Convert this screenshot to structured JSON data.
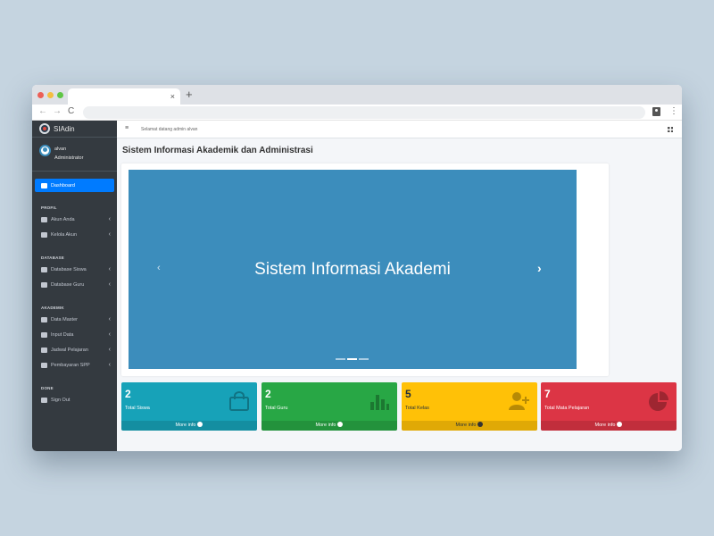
{
  "browser": {
    "tab_close": "×",
    "new_tab": "+",
    "back": "←",
    "forward": "→",
    "reload": "C",
    "menu": "⋮"
  },
  "sidebar": {
    "brand": "SIAdin",
    "user": {
      "name": "alvan",
      "role": "Administrator"
    },
    "items": [
      {
        "type": "item",
        "label": "Dashboard",
        "icon": "home-icon",
        "active": true
      },
      {
        "type": "header",
        "label": "PROFIL"
      },
      {
        "type": "item",
        "label": "Akun Anda",
        "icon": "user-icon",
        "chevron": "‹"
      },
      {
        "type": "item",
        "label": "Kelola Akun",
        "icon": "user-cog-icon",
        "chevron": "‹"
      },
      {
        "type": "header",
        "label": "DATABASE"
      },
      {
        "type": "item",
        "label": "Database Siswa",
        "icon": "users-icon",
        "chevron": "‹"
      },
      {
        "type": "item",
        "label": "Database Guru",
        "icon": "chalkboard-icon",
        "chevron": "‹"
      },
      {
        "type": "header",
        "label": "AKADEMIK"
      },
      {
        "type": "item",
        "label": "Data Master",
        "icon": "book-icon",
        "chevron": "‹"
      },
      {
        "type": "item",
        "label": "Input Data",
        "icon": "plus-circle-icon",
        "chevron": "‹"
      },
      {
        "type": "item",
        "label": "Jadwal Pelajaran",
        "icon": "calendar-icon",
        "chevron": "‹"
      },
      {
        "type": "item",
        "label": "Pembayaran SPP",
        "icon": "money-icon",
        "chevron": "‹"
      },
      {
        "type": "header",
        "label": "DONE"
      },
      {
        "type": "item",
        "label": "Sign Out",
        "icon": "sign-out-icon"
      }
    ]
  },
  "topnav": {
    "menu_icon": "≡",
    "welcome": "Selamat datang admin alvan"
  },
  "page": {
    "title": "Sistem Informasi Akademik dan Administrasi"
  },
  "carousel": {
    "caption": "Sistem Informasi Akademi",
    "prev": "‹",
    "next": "›",
    "indicators": 3,
    "active_index": 1
  },
  "stats": [
    {
      "value": "2",
      "label": "Total Siswa",
      "footer": "More info",
      "color": "#17a2b8",
      "icon": "shopping-bag-icon"
    },
    {
      "value": "2",
      "label": "Total Guru",
      "footer": "More info",
      "color": "#28a745",
      "icon": "bar-chart-icon"
    },
    {
      "value": "5",
      "label": "Total Kelas",
      "footer": "More info",
      "color": "#ffc107",
      "icon": "user-plus-icon"
    },
    {
      "value": "7",
      "label": "Total Mata Pelajaran",
      "footer": "More info",
      "color": "#dc3545",
      "icon": "pie-chart-icon"
    }
  ]
}
